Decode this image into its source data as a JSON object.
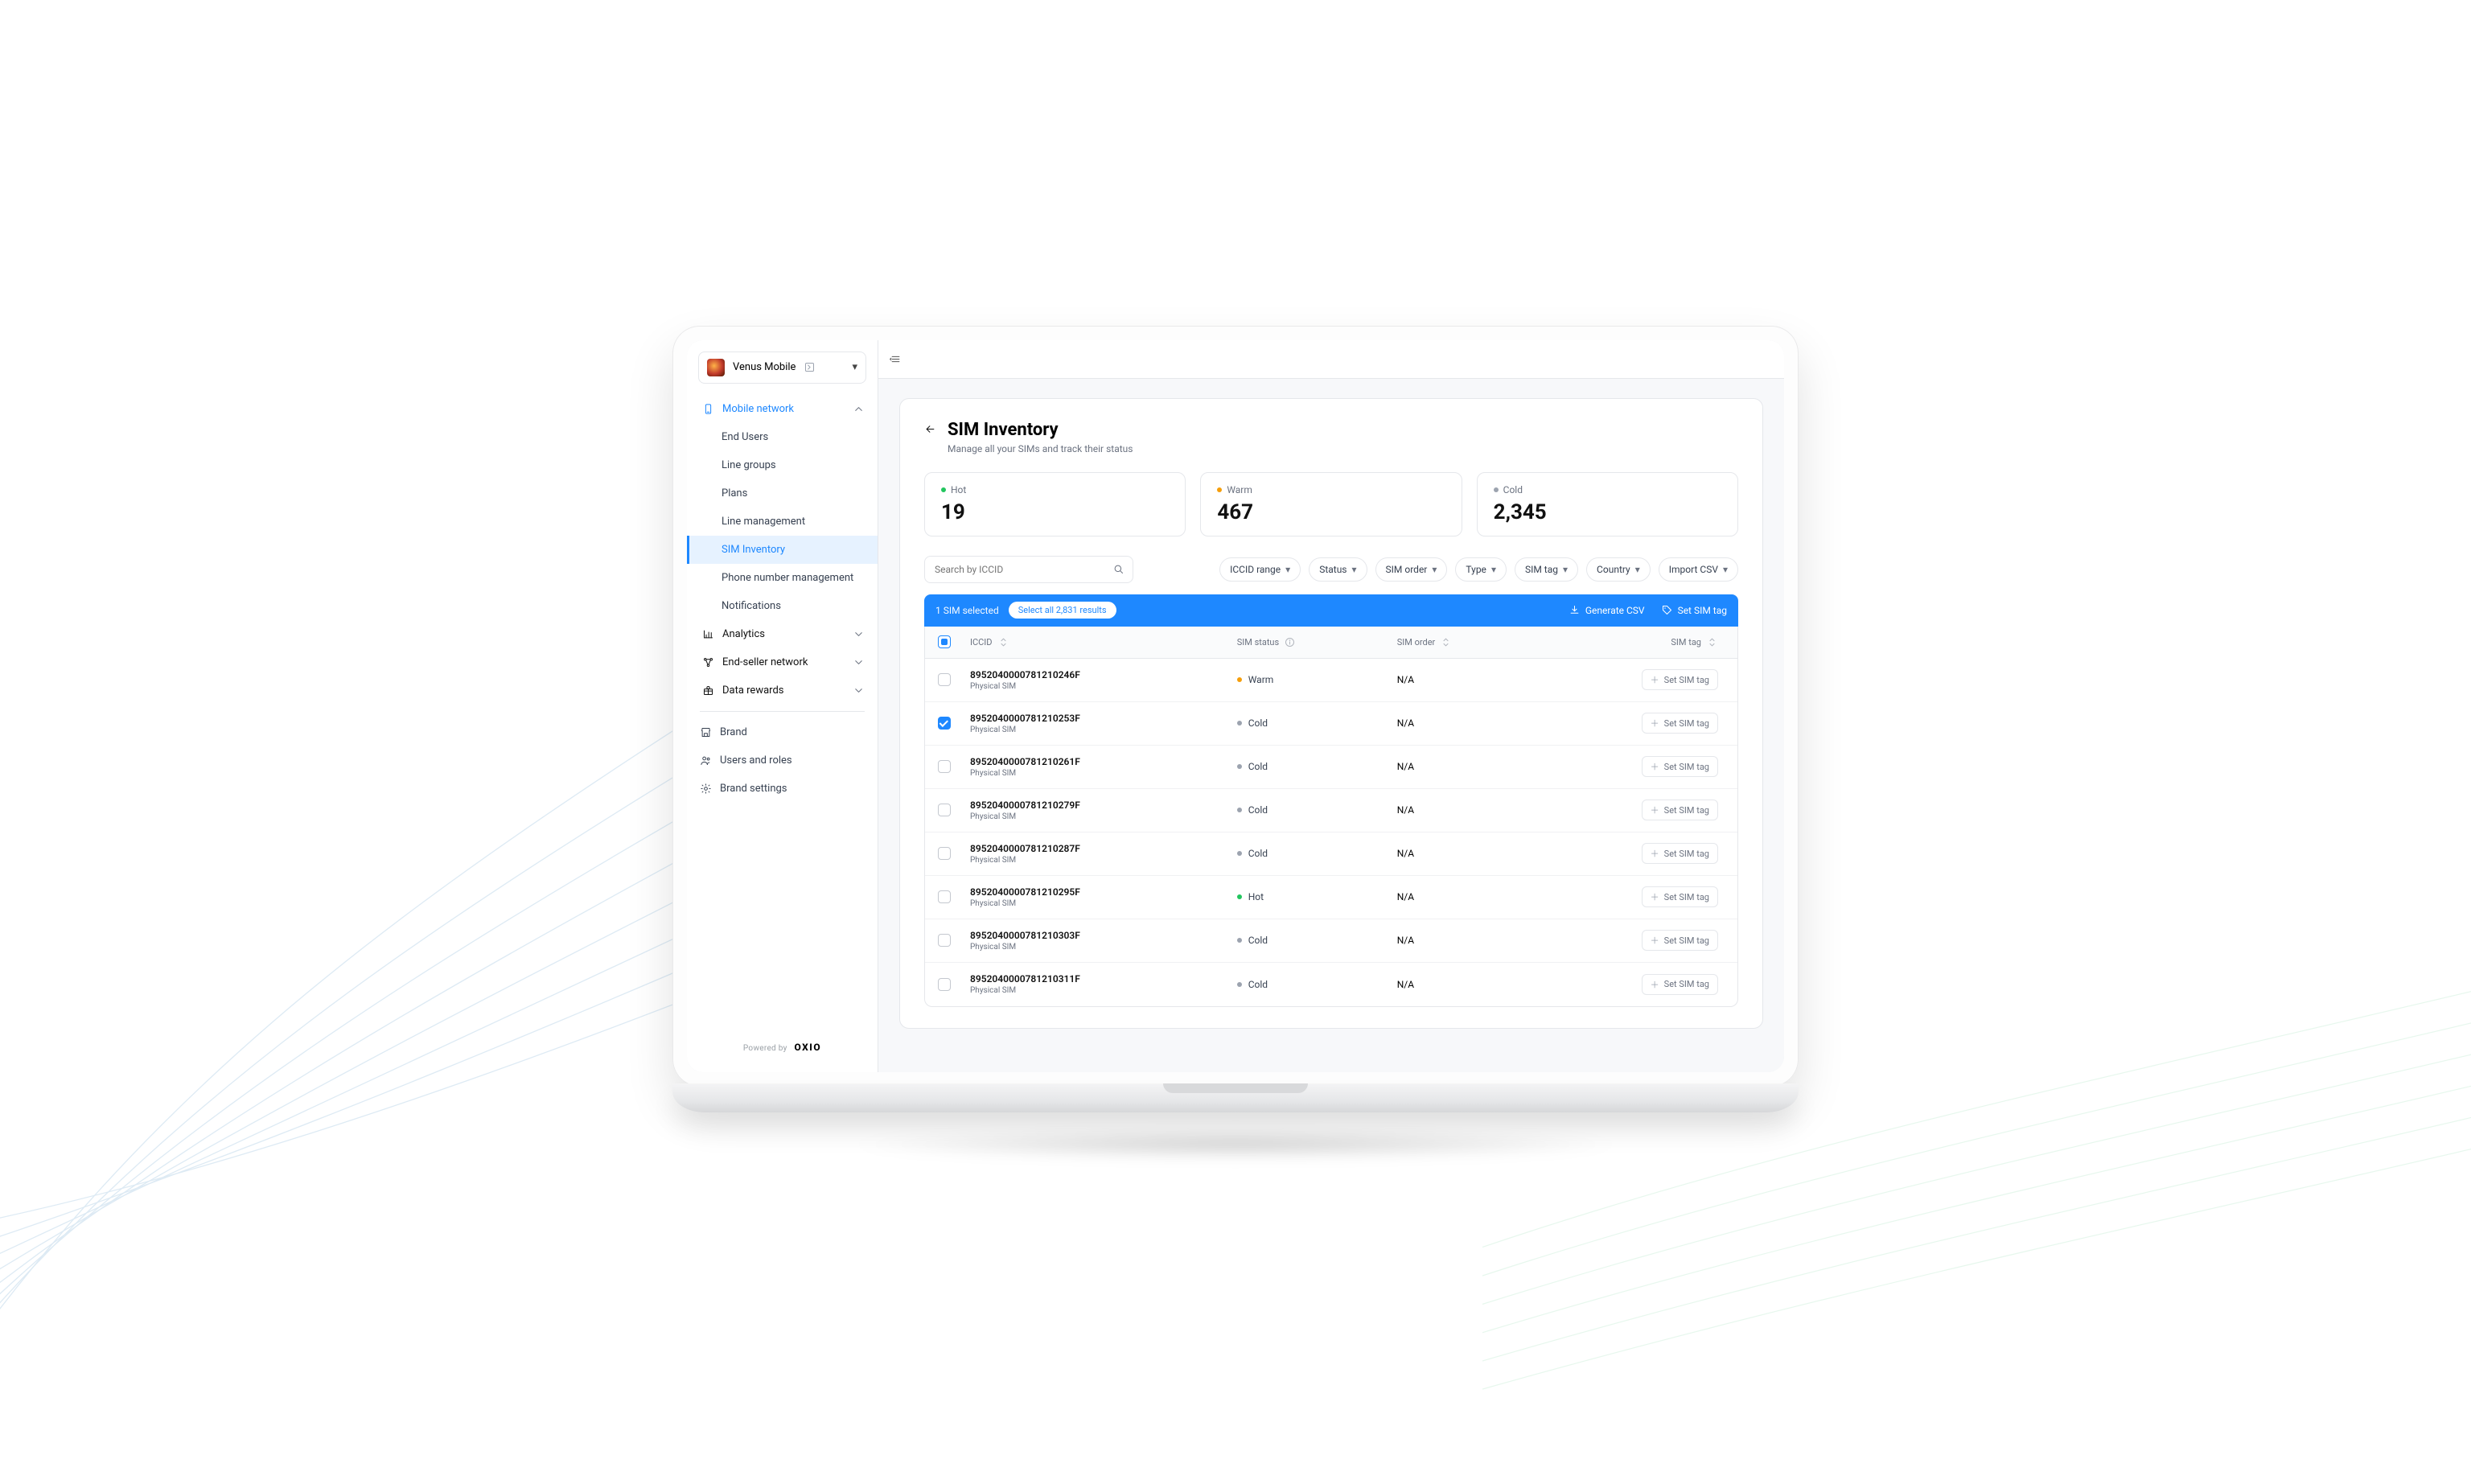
{
  "brand": {
    "name": "Venus Mobile"
  },
  "sidebar": {
    "mobileNetwork": {
      "label": "Mobile network",
      "items": [
        {
          "label": "End Users"
        },
        {
          "label": "Line groups"
        },
        {
          "label": "Plans"
        },
        {
          "label": "Line management"
        },
        {
          "label": "SIM Inventory"
        },
        {
          "label": "Phone number management"
        },
        {
          "label": "Notifications"
        }
      ],
      "selectedIndex": 4
    },
    "analytics": {
      "label": "Analytics"
    },
    "endSeller": {
      "label": "End-seller network"
    },
    "dataRewards": {
      "label": "Data rewards"
    },
    "footer": [
      {
        "label": "Brand",
        "icon": "store"
      },
      {
        "label": "Users and roles",
        "icon": "users"
      },
      {
        "label": "Brand settings",
        "icon": "settings"
      }
    ],
    "poweredBy": {
      "prefix": "Powered by",
      "brand": "OXIO"
    }
  },
  "page": {
    "title": "SIM Inventory",
    "subtitle": "Manage all your SIMs and track their status"
  },
  "stats": [
    {
      "label": "Hot",
      "value": "19",
      "dot": "hot"
    },
    {
      "label": "Warm",
      "value": "467",
      "dot": "warm"
    },
    {
      "label": "Cold",
      "value": "2,345",
      "dot": "cold"
    }
  ],
  "search": {
    "placeholder": "Search by ICCID"
  },
  "filters": [
    {
      "label": "ICCID range"
    },
    {
      "label": "Status"
    },
    {
      "label": "SIM order"
    },
    {
      "label": "Type"
    },
    {
      "label": "SIM tag"
    },
    {
      "label": "Country"
    },
    {
      "label": "Import CSV"
    }
  ],
  "selection": {
    "countText": "1 SIM selected",
    "selectAll": "Select all 2,831 results",
    "actions": [
      {
        "label": "Generate CSV",
        "icon": "download"
      },
      {
        "label": "Set SIM tag",
        "icon": "tag"
      }
    ]
  },
  "table": {
    "columns": [
      "ICCID",
      "SIM status",
      "SIM order",
      "SIM tag"
    ],
    "setTagLabel": "Set SIM tag",
    "rows": [
      {
        "iccid": "8952040000781210246F",
        "type": "Physical SIM",
        "status": "Warm",
        "statusDot": "warm",
        "order": "N/A",
        "checked": false
      },
      {
        "iccid": "8952040000781210253F",
        "type": "Physical SIM",
        "status": "Cold",
        "statusDot": "cold",
        "order": "N/A",
        "checked": true
      },
      {
        "iccid": "8952040000781210261F",
        "type": "Physical SIM",
        "status": "Cold",
        "statusDot": "cold",
        "order": "N/A",
        "checked": false
      },
      {
        "iccid": "8952040000781210279F",
        "type": "Physical SIM",
        "status": "Cold",
        "statusDot": "cold",
        "order": "N/A",
        "checked": false
      },
      {
        "iccid": "8952040000781210287F",
        "type": "Physical SIM",
        "status": "Cold",
        "statusDot": "cold",
        "order": "N/A",
        "checked": false
      },
      {
        "iccid": "8952040000781210295F",
        "type": "Physical SIM",
        "status": "Hot",
        "statusDot": "hot",
        "order": "N/A",
        "checked": false
      },
      {
        "iccid": "8952040000781210303F",
        "type": "Physical SIM",
        "status": "Cold",
        "statusDot": "cold",
        "order": "N/A",
        "checked": false
      },
      {
        "iccid": "8952040000781210311F",
        "type": "Physical SIM",
        "status": "Cold",
        "statusDot": "cold",
        "order": "N/A",
        "checked": false
      }
    ]
  }
}
